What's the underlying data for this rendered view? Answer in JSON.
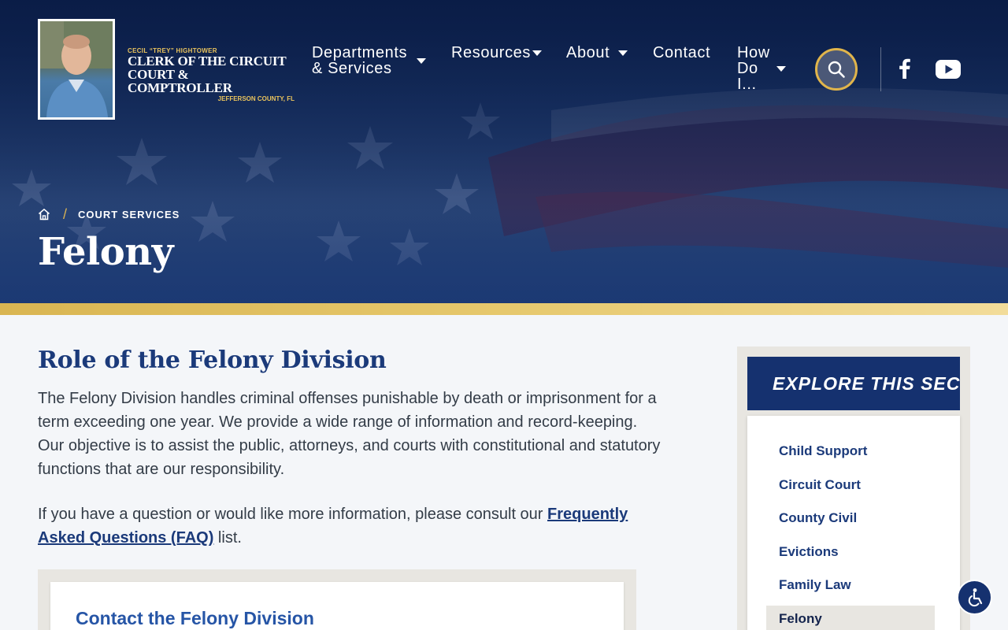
{
  "header": {
    "logo": {
      "subtitle": "CECIL “TREY” HIGHTOWER",
      "title_line1": "CLERK OF THE CIRCUIT",
      "title_line2": "COURT & COMPTROLLER",
      "county": "JEFFERSON COUNTY, FL"
    },
    "nav": [
      {
        "label_line1": "Departments",
        "label_line2": "& Services",
        "has_dropdown": true
      },
      {
        "label": "Resources",
        "has_dropdown": true
      },
      {
        "label": "About",
        "has_dropdown": true
      },
      {
        "label": "Contact",
        "has_dropdown": false
      },
      {
        "label_line1": "How",
        "label_line2": "Do",
        "label_line3": "I...",
        "has_dropdown": true
      }
    ],
    "search_icon": "search-icon",
    "social": [
      "facebook-icon",
      "youtube-icon"
    ]
  },
  "hero": {
    "breadcrumb": {
      "home_icon": "home-icon",
      "separator": "/",
      "current": "COURT SERVICES"
    },
    "page_title": "Felony"
  },
  "main": {
    "heading": "Role of the Felony Division",
    "paragraph1": "The Felony Division handles criminal offenses punishable by death or imprisonment for a term exceeding one year. We provide a wide range of information and record-keeping. Our objective is to assist the public, attorneys, and courts with constitutional and statutory functions that are our responsibility.",
    "paragraph2_before": "If you have a question or would like more information, please consult our ",
    "paragraph2_link": "Frequently Asked Questions (FAQ)",
    "paragraph2_after": " list.",
    "contact_card_title": "Contact the Felony Division"
  },
  "sidebar": {
    "header": "EXPLORE THIS SECTION",
    "items": [
      {
        "label": "Child Support",
        "active": false
      },
      {
        "label": "Circuit Court",
        "active": false
      },
      {
        "label": "County Civil",
        "active": false
      },
      {
        "label": "Evictions",
        "active": false
      },
      {
        "label": "Family Law",
        "active": false
      },
      {
        "label": "Felony",
        "active": true
      }
    ]
  },
  "accessibility_icon": "accessibility-icon",
  "colors": {
    "navy": "#15316f",
    "heading_blue": "#1b3a7a",
    "gold": "#e1b54b",
    "link_blue": "#2655a6"
  }
}
